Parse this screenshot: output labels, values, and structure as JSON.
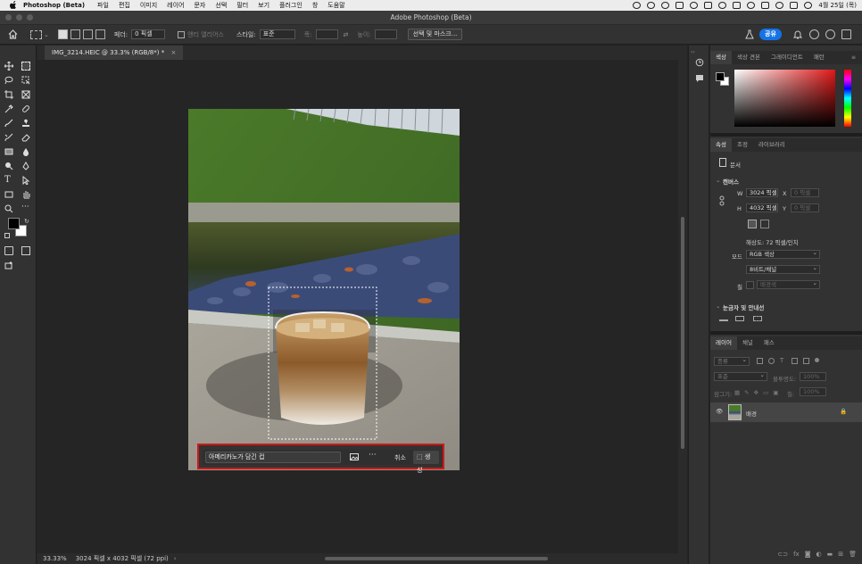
{
  "menubar": {
    "app": "Photoshop (Beta)",
    "items": [
      "파일",
      "편집",
      "이미지",
      "레이어",
      "문자",
      "선택",
      "필터",
      "보기",
      "플러그인",
      "창",
      "도움말"
    ],
    "datetime": "4월 25일 (목)"
  },
  "window": {
    "title": "Adobe Photoshop (Beta)"
  },
  "options": {
    "feather_label": "페더:",
    "feather_value": "0 픽셀",
    "antialias": "앤티 앨리어스",
    "style_label": "스타일:",
    "style_value": "표준",
    "width_label": "폭:",
    "height_label": "높이:",
    "select_mask": "선택 및 마스크...",
    "share": "공유"
  },
  "document": {
    "tab": "IMG_3214.HEIC @ 33.3% (RGB/8*) *",
    "zoom": "33.33%",
    "info": "3024 픽셀 x 4032 픽셀 (72 ppi)"
  },
  "contextual": {
    "prompt": "아메리카노가 담긴 컵",
    "more": "···",
    "cancel": "취소",
    "generate": "생성"
  },
  "color_panel": {
    "tabs": [
      "색상",
      "색상 견본",
      "그레이디언트",
      "패턴"
    ]
  },
  "properties_panel": {
    "tabs": [
      "속성",
      "조정",
      "라이브러리"
    ],
    "doc_label": "문서",
    "canvas_heading": "캔버스",
    "w_label": "W",
    "w_value": "3024 픽셀",
    "h_label": "H",
    "h_value": "4032 픽셀",
    "x_label": "X",
    "x_placeholder": "0 픽셀",
    "y_label": "Y",
    "y_placeholder": "0 픽셀",
    "resolution": "해상도: 72 픽셀/인치",
    "mode_label": "모드",
    "mode_value": "RGB 색상",
    "depth_value": "8비트/채널",
    "fill_label": "칠",
    "fill_value": "배경색",
    "rulers_heading": "눈금자 및 안내선"
  },
  "layers_panel": {
    "tabs": [
      "레이어",
      "채널",
      "패스"
    ],
    "filter_value": "종류",
    "blend_value": "표준",
    "opacity_label": "불투명도:",
    "opacity_value": "100%",
    "lock_label": "잠그기:",
    "fill_label": "칠:",
    "fill_value": "100%",
    "layer_name": "배경"
  },
  "colors": {
    "accent": "#1473e6",
    "highlight": "#d01818",
    "foreground": "#000000",
    "background": "#ffffff"
  }
}
